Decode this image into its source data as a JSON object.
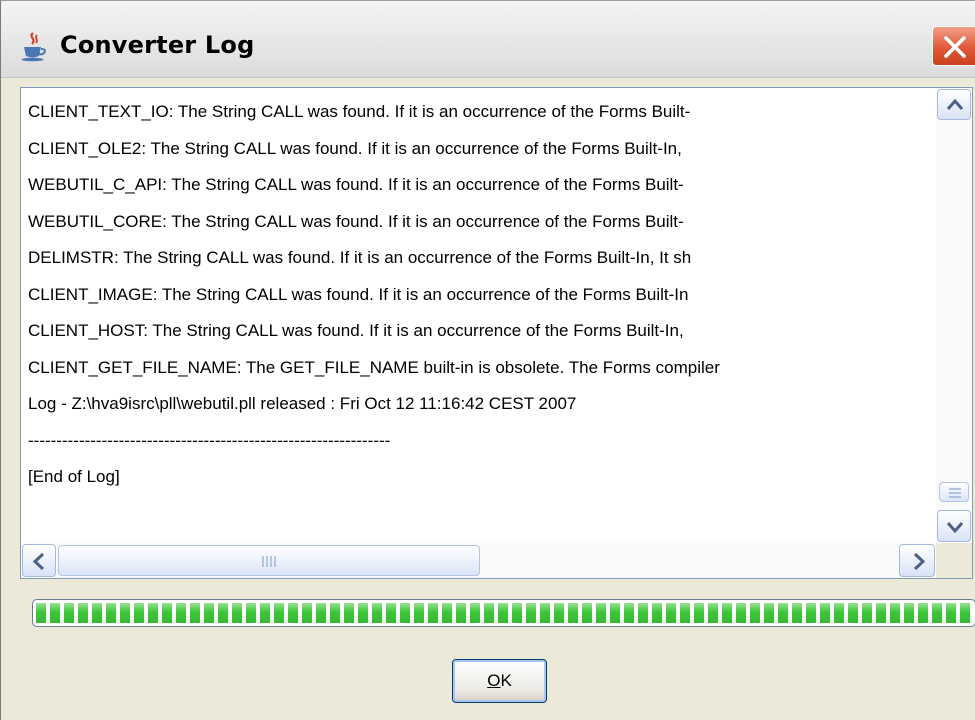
{
  "window": {
    "title": "Converter Log",
    "app_icon": "java-cup-icon",
    "close_icon": "close-icon"
  },
  "log": {
    "lines": [
      "CLIENT_TEXT_IO: The String CALL was found. If it is an occurrence of the Forms Built-",
      "CLIENT_OLE2: The String CALL was found. If it is an occurrence of the Forms Built-In,",
      "WEBUTIL_C_API: The String CALL was found. If it is an occurrence of the Forms Built-",
      "WEBUTIL_CORE: The String CALL was found. If it is an occurrence of the Forms Built-",
      "DELIMSTR: The String CALL was found. If it is an occurrence of the Forms Built-In, It sh",
      "CLIENT_IMAGE: The String CALL was found. If it is an occurrence of the Forms Built-In",
      "CLIENT_HOST: The String CALL was found. If it is an occurrence of the Forms Built-In,",
      "CLIENT_GET_FILE_NAME: The GET_FILE_NAME built-in is obsolete. The Forms compiler",
      "Log - Z:\\hva9isrc\\pll\\webutil.pll released : Fri Oct 12 11:16:42 CEST 2007",
      "----------------------------------------------------------------",
      "[End of Log]"
    ]
  },
  "scrollbars": {
    "up_icon": "arrow-up-icon",
    "down_icon": "arrow-down-icon",
    "left_icon": "arrow-left-icon",
    "right_icon": "arrow-right-icon"
  },
  "progress": {
    "fraction": 1.0,
    "color": "#3ec63a"
  },
  "ok_button": {
    "mnemonic": "O",
    "rest": "K"
  },
  "colors": {
    "window_bg": "#ece9d8",
    "close_red": "#e05a3a",
    "border_blue": "#7f9db9"
  }
}
